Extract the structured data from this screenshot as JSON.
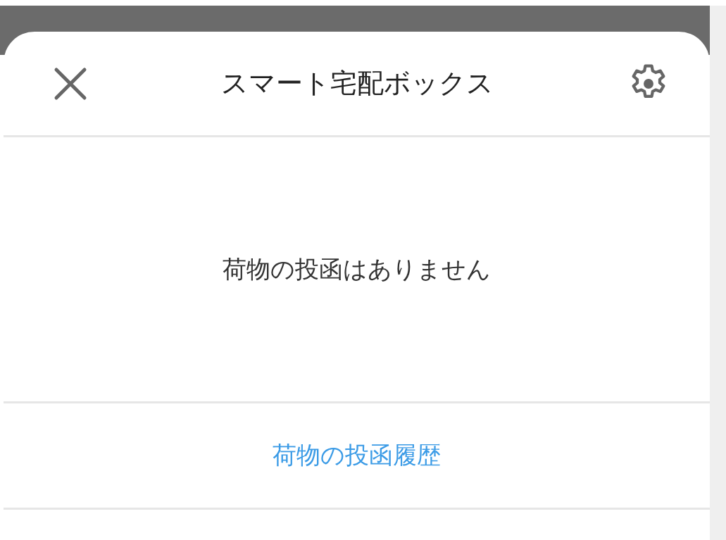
{
  "header": {
    "title": "スマート宅配ボックス"
  },
  "message": "荷物の投函はありません",
  "history_link": "荷物の投函履歴"
}
